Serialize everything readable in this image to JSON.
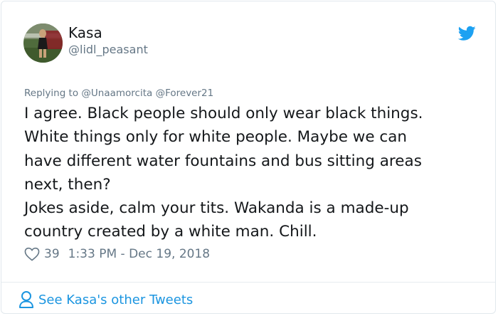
{
  "author": {
    "display_name": "Kasa",
    "handle": "@lidl_peasant"
  },
  "reply": {
    "prefix": "Replying to",
    "mentions": [
      "@Unaamorcita",
      "@Forever21"
    ]
  },
  "tweet": {
    "lines": [
      "I agree. Black people should only wear black things.",
      "White things only for white people. Maybe we can",
      "have different water fountains and bus sitting areas",
      "next, then?",
      "Jokes aside, calm your tits. Wakanda is a made-up",
      "country created by a white man. Chill."
    ]
  },
  "meta": {
    "likes": "39",
    "timestamp": "1:33 PM - Dec 19, 2018"
  },
  "footer": {
    "link_text": "See Kasa's other Tweets"
  },
  "colors": {
    "brand_blue": "#1da1f2",
    "link_blue": "#1b95e0",
    "text": "#14171a",
    "muted": "#657786"
  },
  "icons": {
    "platform": "twitter-bird-icon",
    "like": "heart-icon",
    "profile": "person-icon"
  }
}
